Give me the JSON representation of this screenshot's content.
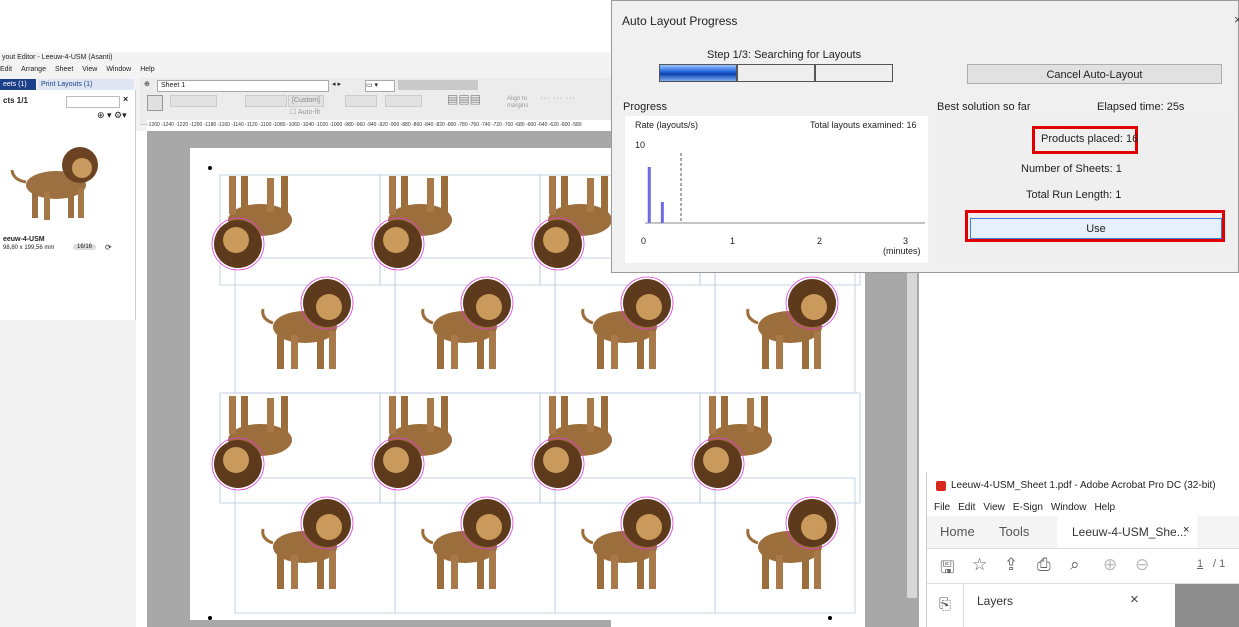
{
  "editor": {
    "title": "yout Editor - Leeuw-4-USM (Asanti)",
    "menu": [
      "Edit",
      "Arrange",
      "Sheet",
      "View",
      "Window",
      "Help"
    ],
    "tabs": [
      {
        "label": "eets (1)"
      },
      {
        "label": "Print Layouts (1)"
      }
    ],
    "objects_label": "cts 1/1",
    "sheet_select": "Sheet 1",
    "custom_label": "[Custom]",
    "autofit_label": "Auto-fit",
    "align_label": "Align to margins",
    "ruler_text": "-1260 -1240 -1220 -1200 -1180 -1160 -1140 -1120 -1100 -1080 -1060 -1040 -1020 -1000 -980 -960 -940 -920 -900 -880 -860 -840 -820 -800 -780 -760 -740 -720 -700 -680 -660 -640 -620 -600 -580",
    "product": {
      "name": "eeuw-4-USM",
      "size": "98,80 x 199,56 mm",
      "count": "16/16"
    }
  },
  "dialog": {
    "title": "Auto Layout Progress",
    "step_text": "Step 1/3: Searching for Layouts",
    "cancel_button": "Cancel Auto-Layout",
    "progress_label": "Progress",
    "best_label": "Best solution so far",
    "elapsed": "Elapsed time: 25s",
    "chart_rate_label": "Rate (layouts/s)",
    "chart_total_label": "Total layouts examined: 16",
    "y_tick": "10",
    "x_ticks": [
      "0",
      "1",
      "2",
      "3"
    ],
    "x_unit": "(minutes)",
    "products_placed": "Products placed:  16",
    "number_of_sheets": "Number of Sheets:  1",
    "total_run_length": "Total Run Length:  1",
    "use_button": "Use"
  },
  "chart_data": {
    "type": "bar",
    "x": [
      0.02,
      0.17
    ],
    "values": [
      8,
      3
    ],
    "ylim": [
      0,
      10
    ],
    "xlim": [
      0,
      3
    ],
    "colors": {
      "bar": "#6b6be6",
      "marker": "#555555"
    }
  },
  "acrobat": {
    "title": "Leeuw-4-USM_Sheet 1.pdf - Adobe Acrobat Pro DC (32-bit)",
    "menu": [
      "File",
      "Edit",
      "View",
      "E-Sign",
      "Window",
      "Help"
    ],
    "tabs": {
      "home": "Home",
      "tools": "Tools",
      "doc": "Leeuw-4-USM_She..."
    },
    "page_num": "1",
    "page_total": "/ 1",
    "layers_label": "Layers"
  },
  "colors": {
    "accent": "#1a5fd8",
    "highlight": "#e00000",
    "cutline": "#e03ad8"
  }
}
